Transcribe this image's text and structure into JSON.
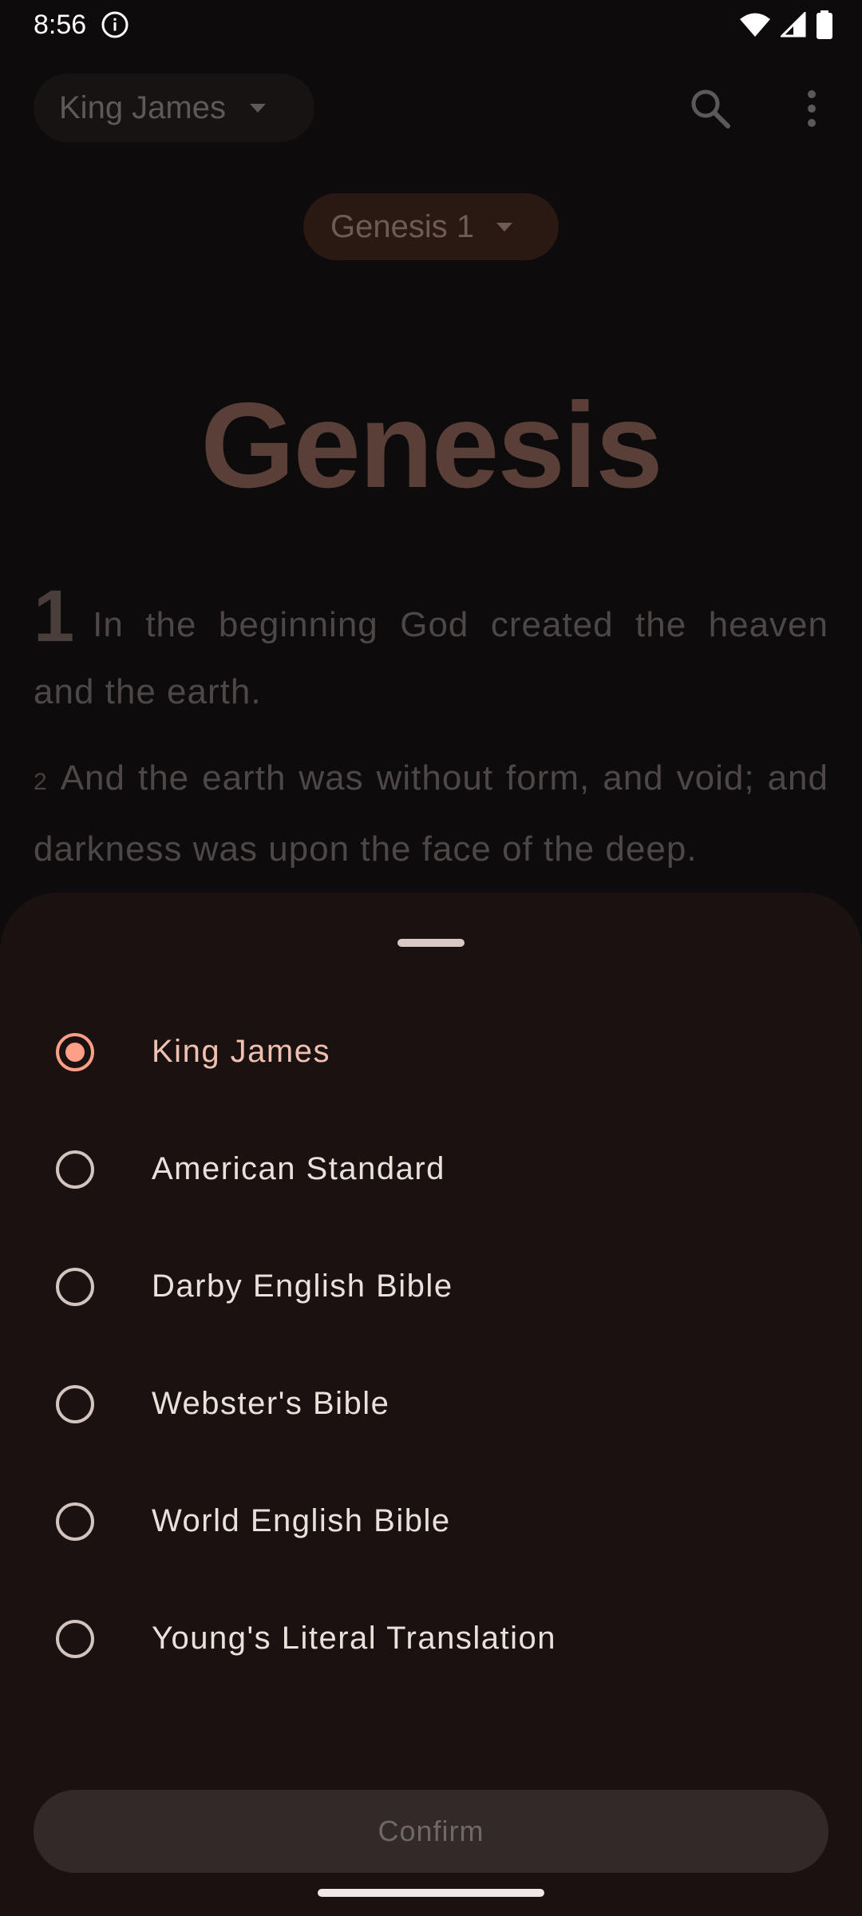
{
  "status_bar": {
    "time": "8:56",
    "icons": [
      "info-icon",
      "wifi-icon",
      "cellular-signal-icon",
      "battery-icon"
    ]
  },
  "app_bar": {
    "version_selector_label": "King James",
    "icons": [
      "chevron-down-icon",
      "search-icon",
      "more-vert-icon"
    ]
  },
  "chapter_selector": {
    "label": "Genesis 1"
  },
  "reader": {
    "book_title": "Genesis",
    "verses": [
      {
        "number": "1",
        "text": "In the beginning God created the heaven and the earth."
      },
      {
        "number": "2",
        "text": "And the earth was without form, and void; and darkness was upon the face of the deep."
      }
    ]
  },
  "version_sheet": {
    "options": [
      {
        "label": "King James",
        "selected": true
      },
      {
        "label": "American Standard",
        "selected": false
      },
      {
        "label": "Darby English Bible",
        "selected": false
      },
      {
        "label": "Webster's Bible",
        "selected": false
      },
      {
        "label": "World English Bible",
        "selected": false
      },
      {
        "label": "Young's Literal Translation",
        "selected": false
      }
    ],
    "confirm_label": "Confirm"
  },
  "colors": {
    "accent": "#ff9f87",
    "sheet_background": "#1a1211",
    "screen_background": "#0d0b0b",
    "button_disabled": "#312a29"
  }
}
